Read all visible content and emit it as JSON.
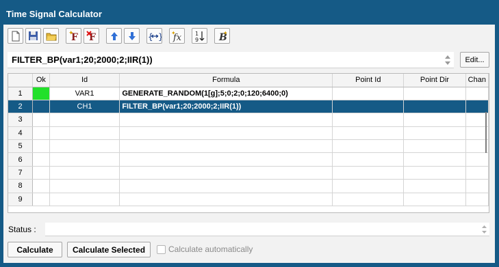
{
  "window": {
    "title": "Time Signal Calculator"
  },
  "toolbar": {
    "buttons": [
      {
        "icon": "new-document-icon"
      },
      {
        "icon": "save-icon"
      },
      {
        "icon": "open-folder-icon"
      },
      {
        "icon": "add-function-icon"
      },
      {
        "icon": "delete-function-icon"
      },
      {
        "icon": "move-up-icon"
      },
      {
        "icon": "move-down-icon"
      },
      {
        "icon": "expand-braces-icon"
      },
      {
        "icon": "function-fx-icon"
      },
      {
        "icon": "sort-numeric-icon"
      },
      {
        "icon": "bold-b-icon"
      }
    ]
  },
  "formula_bar": {
    "value": "FILTER_BP(var1;20;2000;2;IIR(1))",
    "edit_label": "Edit..."
  },
  "grid": {
    "columns": [
      "",
      "Ok",
      "Id",
      "Formula",
      "Point Id",
      "Point Dir",
      "Chan"
    ],
    "rows": [
      {
        "num": "1",
        "ok": "green",
        "id": "VAR1",
        "formula": "GENERATE_RANDOM(1[g];5;0;2;0;120;6400;0)",
        "point_id": "",
        "point_dir": "",
        "chan": ""
      },
      {
        "num": "2",
        "ok": "",
        "id": "CH1",
        "formula": "FILTER_BP(var1;20;2000;2;IIR(1))",
        "point_id": "",
        "point_dir": "",
        "chan": "",
        "selected": true
      },
      {
        "num": "3",
        "ok": "",
        "id": "",
        "formula": "",
        "point_id": "",
        "point_dir": "",
        "chan": ""
      },
      {
        "num": "4",
        "ok": "",
        "id": "",
        "formula": "",
        "point_id": "",
        "point_dir": "",
        "chan": ""
      },
      {
        "num": "5",
        "ok": "",
        "id": "",
        "formula": "",
        "point_id": "",
        "point_dir": "",
        "chan": ""
      },
      {
        "num": "6",
        "ok": "",
        "id": "",
        "formula": "",
        "point_id": "",
        "point_dir": "",
        "chan": ""
      },
      {
        "num": "7",
        "ok": "",
        "id": "",
        "formula": "",
        "point_id": "",
        "point_dir": "",
        "chan": ""
      },
      {
        "num": "8",
        "ok": "",
        "id": "",
        "formula": "",
        "point_id": "",
        "point_dir": "",
        "chan": ""
      },
      {
        "num": "9",
        "ok": "",
        "id": "",
        "formula": "",
        "point_id": "",
        "point_dir": "",
        "chan": ""
      }
    ]
  },
  "status": {
    "label": "Status :",
    "value": ""
  },
  "actions": {
    "calculate_label": "Calculate",
    "calculate_selected_label": "Calculate Selected",
    "auto_label": "Calculate automatically",
    "auto_checked": false
  },
  "colors": {
    "title_bar": "#155a86",
    "selection": "#155a86",
    "ok_status": "#22e02a"
  }
}
